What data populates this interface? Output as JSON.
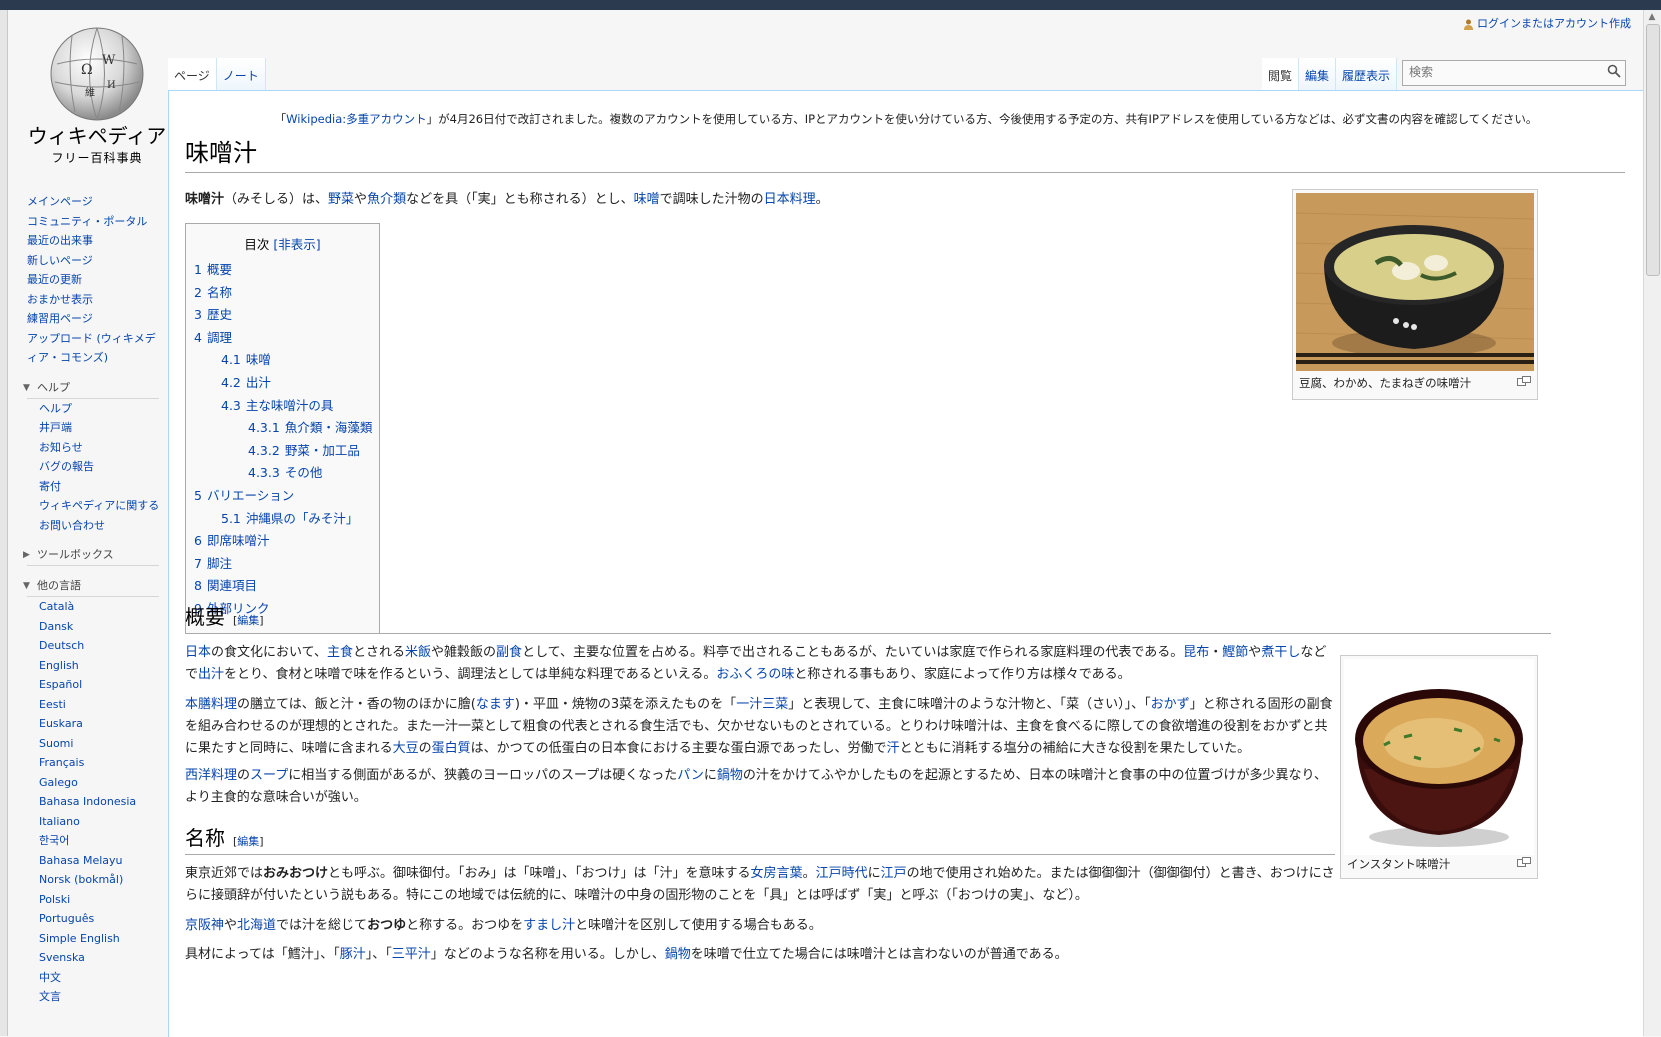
{
  "header": {
    "login_label": "ログインまたはアカウント作成",
    "search_placeholder": "検索",
    "tabs_left": [
      "ページ",
      "ノート"
    ],
    "tabs_right": [
      "閲覧",
      "編集",
      "履歴表示"
    ]
  },
  "logo": {
    "title": "ウィキペディア",
    "subtitle": "フリー百科事典"
  },
  "sidebar": {
    "nav": [
      "メインページ",
      "コミュニティ・ポータル",
      "最近の出来事",
      "新しいページ",
      "最近の更新",
      "おまかせ表示",
      "練習用ページ",
      "アップロード (ウィキメディア・コモンズ)"
    ],
    "help_title": "ヘルプ",
    "help": [
      "ヘルプ",
      "井戸端",
      "お知らせ",
      "バグの報告",
      "寄付",
      "ウィキペディアに関するお問い合わせ"
    ],
    "toolbox_title": "ツールボックス",
    "lang_title": "他の言語",
    "languages": [
      "Català",
      "Dansk",
      "Deutsch",
      "English",
      "Español",
      "Eesti",
      "Euskara",
      "Suomi",
      "Français",
      "Galego",
      "Bahasa Indonesia",
      "Italiano",
      "한국어",
      "Bahasa Melayu",
      "Norsk (bokmål)",
      "Polski",
      "Português",
      "Simple English",
      "Svenska",
      "中文",
      "文言"
    ]
  },
  "article": {
    "notice_pre": "「",
    "notice_link": "Wikipedia:多重アカウント",
    "notice_post": "」が4月26日付で改訂されました。複数のアカウントを使用している方、IPとアカウントを使い分けている方、今後使用する予定の方、共有IPアドレスを使用している方などは、必ず文書の内容を確認してください。",
    "title": "味噌汁",
    "intro": {
      "bold": "味噌汁",
      "t1": "（みそしる）は、",
      "l1": "野菜",
      "t2": "や",
      "l2": "魚介類",
      "t3": "などを具（「実」とも称される）とし、",
      "l3": "味噌",
      "t4": "で調味した汁物の",
      "l4": "日本料理",
      "t5": "。"
    },
    "toc": {
      "title": "目次",
      "toggle": "[非表示]",
      "items": [
        {
          "num": "1",
          "label": "概要"
        },
        {
          "num": "2",
          "label": "名称"
        },
        {
          "num": "3",
          "label": "歴史"
        },
        {
          "num": "4",
          "label": "調理"
        },
        {
          "num": "4.1",
          "label": "味噌"
        },
        {
          "num": "4.2",
          "label": "出汁"
        },
        {
          "num": "4.3",
          "label": "主な味噌汁の具"
        },
        {
          "num": "4.3.1",
          "label": "魚介類・海藻類"
        },
        {
          "num": "4.3.2",
          "label": "野菜・加工品"
        },
        {
          "num": "4.3.3",
          "label": "その他"
        },
        {
          "num": "5",
          "label": "バリエーション"
        },
        {
          "num": "5.1",
          "label": "沖縄県の「みそ汁」"
        },
        {
          "num": "6",
          "label": "即席味噌汁"
        },
        {
          "num": "7",
          "label": "脚注"
        },
        {
          "num": "8",
          "label": "関連項目"
        },
        {
          "num": "9",
          "label": "外部リンク"
        }
      ]
    },
    "image1_caption": "豆腐、わかめ、たまねぎの味噌汁",
    "image2_caption": "インスタント味噌汁",
    "edit_label": "[編集]",
    "h_overview": "概要",
    "h_name": "名称",
    "p1": {
      "l1": "日本",
      "t1": "の食文化において、",
      "l2": "主食",
      "t2": "とされる",
      "l3": "米飯",
      "t3": "や雑穀飯の",
      "l4": "副食",
      "t4": "として、主要な位置を占める。料亭で出されることもあるが、たいていは家庭で作られる家庭料理の代表である。",
      "l5": "昆布",
      "t5": "・",
      "l6": "鰹節",
      "t6": "や",
      "l7": "煮干し",
      "t7": "など",
      "line2a": "で",
      "l8": "出汁",
      "t8": "をとり、食材と味噌で味を作るという、調理法としては単純な料理であるといえる。",
      "l9": "おふくろの味",
      "t9": "と称される事もあり、家庭によって作り方は様々である。"
    },
    "p2": {
      "l1": "本膳料理",
      "t1": "の膳立ては、飯と汁・香の物のほかに膾(",
      "l2": "なます",
      "t2": ")・平皿・焼物の3菜を添えたものを「",
      "l3": "一汁三菜",
      "t3": "」と表現して、主食に味噌汁のような汁物と、「菜（さい）」、「",
      "l4": "おかず",
      "t4": "」と称される固形の副食",
      "line2": "を組み合わせるのが理想的とされた。また一汁一菜として粗食の代表とされる食生活でも、欠かせないものとされている。とりわけ味噌汁は、主食を食べるに際しての食欲増進の役割をおかず",
      "t5": "と共に果たすと同時に、味噌に含まれる",
      "l5": "大豆",
      "t6": "の",
      "l6": "蛋白質",
      "t7": "は、かつての低蛋白の日本食における主要な蛋白源であったし、労働で",
      "l7": "汗",
      "t8": "とともに消耗する塩分の補給に大きな役割を果たしていた。"
    },
    "p3": {
      "l1": "西洋料理",
      "t1": "の",
      "l2": "スープ",
      "t2": "に相当する側面があるが、狭義のヨーロッパのスープは硬くなった",
      "l3": "パン",
      "t3": "に",
      "l4": "鍋物",
      "t4": "の汁をかけてふやかしたものを起源とするため、日本の味噌汁と食事の中の位置づけが多少異な",
      "line2": "り、より主食的な意味合いが強い。"
    },
    "p4": {
      "t1": "東京近郊では",
      "b1": "おみおつけ",
      "t2": "とも呼ぶ。御味御付。「おみ」は「味噌」、「おつけ」は「汁」を意味する",
      "l1": "女房言葉",
      "t3": "。",
      "l2": "江戸時代",
      "t4": "に",
      "l3": "江戸",
      "t5": "の地で使用され始めた。または御御御汁（御御御付）と書き、おつけにさ",
      "line2": "らに接頭辞が付いたという説もある。特にこの地域では伝統的に、味噌汁の中身の固形物のことを「具」とは呼ばず「実」と呼ぶ（「おつけの実」、など）。"
    },
    "p5": {
      "l1": "京阪神",
      "t1": "や",
      "l2": "北海道",
      "t2": "では汁を総じて",
      "b1": "おつゆ",
      "t3": "と称する。おつゆを",
      "l3": "すまし汁",
      "t4": "と味噌汁を区別して使用する場合もある。"
    },
    "p6": {
      "t1": "具材によっては「鱈汁」、「",
      "l1": "豚汁",
      "t2": "」、「",
      "l2": "三平汁",
      "t3": "」などのような名称を用いる。しかし、",
      "l3": "鍋物",
      "t4": "を味噌で仕立てた場合には味噌汁とは言わないのが普通である。"
    }
  },
  "colors": {
    "link": "#0645ad",
    "content_border": "#a7d7f9",
    "sidebar_bg": "#f6f6f6"
  }
}
